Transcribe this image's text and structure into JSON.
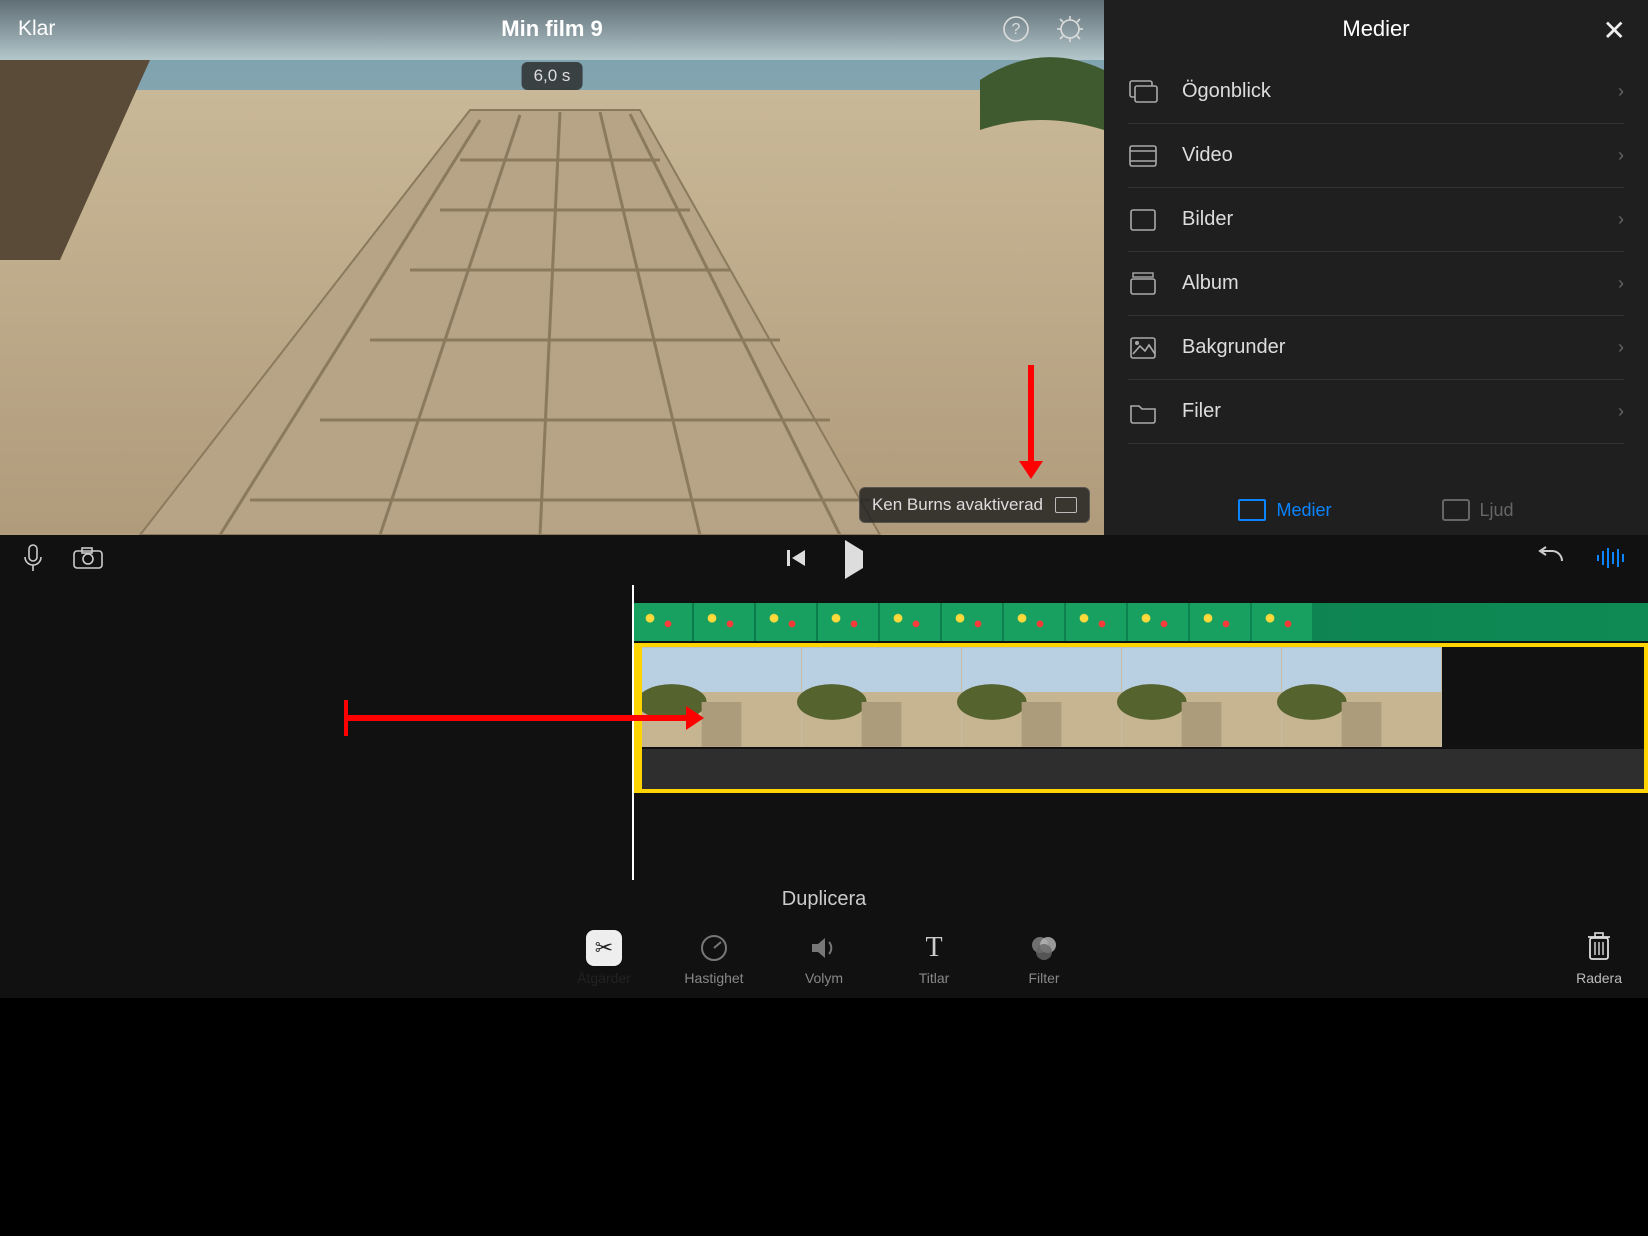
{
  "header": {
    "done": "Klar",
    "title": "Min film 9"
  },
  "preview": {
    "time_pill": "6,0 s",
    "ken_burns": "Ken Burns avaktiverad"
  },
  "media": {
    "title": "Medier",
    "items": [
      {
        "label": "Ögonblick",
        "icon": "moments"
      },
      {
        "label": "Video",
        "icon": "video"
      },
      {
        "label": "Bilder",
        "icon": "photos"
      },
      {
        "label": "Album",
        "icon": "albums"
      },
      {
        "label": "Bakgrunder",
        "icon": "backgrounds"
      },
      {
        "label": "Filer",
        "icon": "files"
      }
    ],
    "tabs": {
      "media": "Medier",
      "audio": "Ljud"
    }
  },
  "timeline": {
    "duplicate_label": "Duplicera"
  },
  "tools": {
    "actions": "Åtgärder",
    "speed": "Hastighet",
    "volume": "Volym",
    "titles": "Titlar",
    "filter": "Filter",
    "delete": "Radera"
  }
}
